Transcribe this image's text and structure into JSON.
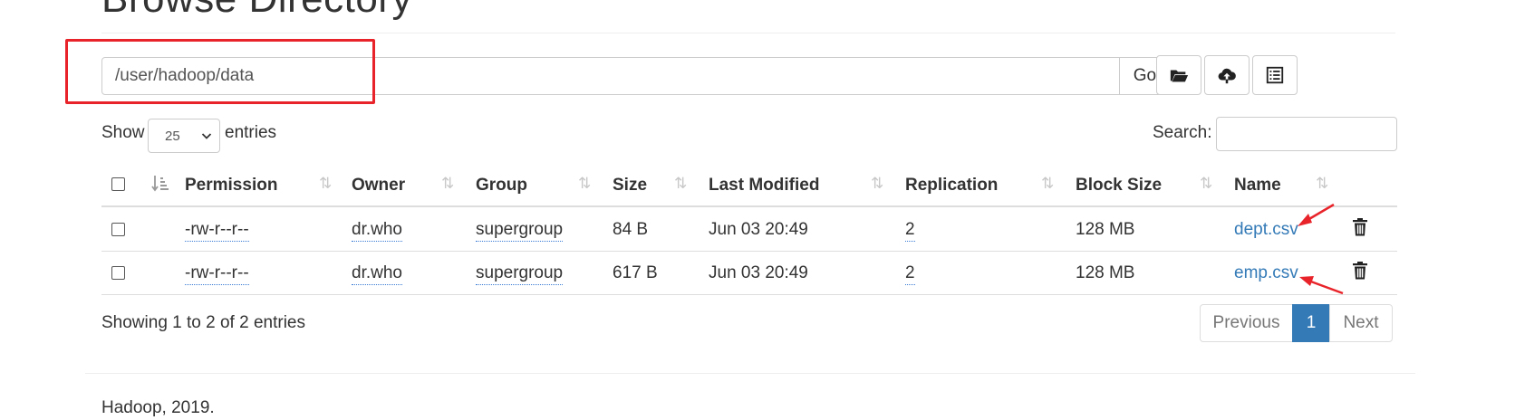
{
  "page_title": "Browse Directory",
  "path": {
    "value": "/user/hadoop/data",
    "go_label": "Go!"
  },
  "toolbar": {
    "icons": [
      "folder-open-icon",
      "cloud-upload-icon",
      "list-icon"
    ]
  },
  "length": {
    "show_label": "Show",
    "selected": "25",
    "entries_label": "entries"
  },
  "search": {
    "label": "Search:",
    "value": ""
  },
  "table": {
    "headers": [
      "Permission",
      "Owner",
      "Group",
      "Size",
      "Last Modified",
      "Replication",
      "Block Size",
      "Name"
    ],
    "rows": [
      {
        "permission": "-rw-r--r--",
        "owner": "dr.who",
        "group": "supergroup",
        "size": "84 B",
        "modified": "Jun 03 20:49",
        "replication": "2",
        "block_size": "128 MB",
        "name": "dept.csv"
      },
      {
        "permission": "-rw-r--r--",
        "owner": "dr.who",
        "group": "supergroup",
        "size": "617 B",
        "modified": "Jun 03 20:49",
        "replication": "2",
        "block_size": "128 MB",
        "name": "emp.csv"
      }
    ]
  },
  "info": "Showing 1 to 2 of 2 entries",
  "pagination": {
    "previous": "Previous",
    "current": "1",
    "next": "Next"
  },
  "footer": "Hadoop, 2019.",
  "colors": {
    "link": "#337ab7",
    "annotation": "#e8242a",
    "active_page": "#337ab7"
  }
}
